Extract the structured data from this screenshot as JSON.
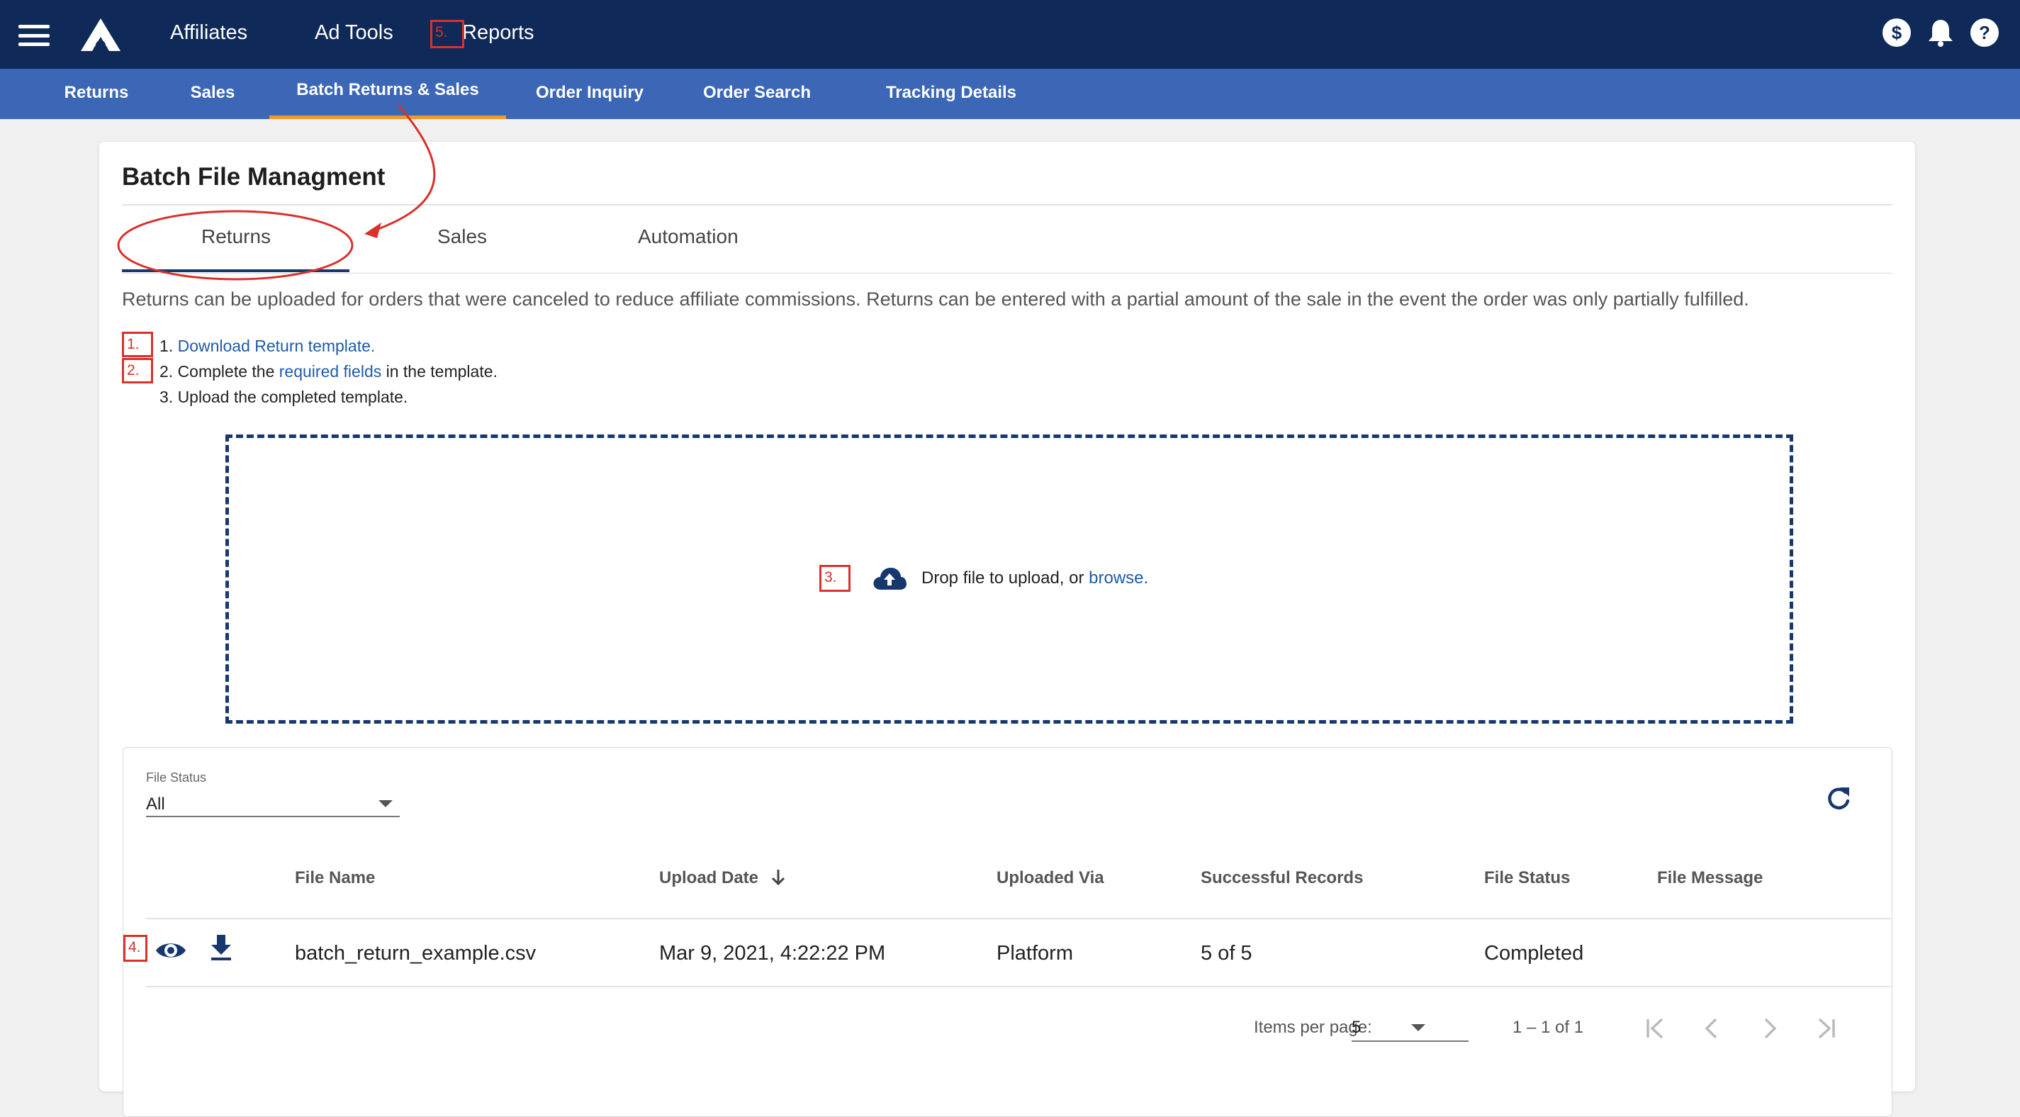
{
  "header": {
    "nav": [
      {
        "label": "Affiliates"
      },
      {
        "label": "Ad Tools"
      },
      {
        "label": "Reports"
      }
    ],
    "icons": [
      "menu-icon",
      "logo",
      "dollar-icon",
      "bell-icon",
      "help-icon"
    ]
  },
  "subnav": {
    "items": [
      {
        "label": "Returns"
      },
      {
        "label": "Sales"
      },
      {
        "label": "Batch Returns & Sales"
      },
      {
        "label": "Order Inquiry"
      },
      {
        "label": "Order Search"
      },
      {
        "label": "Tracking Details"
      }
    ],
    "active_index": 2,
    "accent_color": "#f3962b"
  },
  "page": {
    "title": "Batch File Managment",
    "tabs": [
      {
        "label": "Returns"
      },
      {
        "label": "Sales"
      },
      {
        "label": "Automation"
      }
    ],
    "active_tab": "Returns",
    "intro": "Returns can be uploaded for orders that were canceled to reduce affiliate commissions. Returns can be entered with a partial amount of the sale in the event the order was only partially fulfilled.",
    "steps": {
      "s1_prefix": "1. ",
      "s1_link": "Download Return template.",
      "s2_prefix": "2. Complete the ",
      "s2_link": "required fields",
      "s2_suffix": " in the template.",
      "s3": "3. Upload the completed template."
    },
    "dropzone": {
      "text": "Drop file to upload, or ",
      "link": "browse."
    }
  },
  "table": {
    "filter_label": "File Status",
    "filter_value": "All",
    "columns": [
      "File Name",
      "Upload Date",
      "Uploaded Via",
      "Successful Records",
      "File Status",
      "File Message"
    ],
    "sort_column": "Upload Date",
    "sort_direction": "descending",
    "rows": [
      {
        "file_name": "batch_return_example.csv",
        "upload_date": "Mar 9, 2021, 4:22:22 PM",
        "uploaded_via": "Platform",
        "successful_records": "5 of 5",
        "file_status": "Completed",
        "file_message": ""
      }
    ],
    "paginator": {
      "items_per_page_label": "Items per page:",
      "items_per_page": "5",
      "range": "1 – 1 of 1"
    }
  },
  "annotations": [
    "1.",
    "2.",
    "3.",
    "4.",
    "5."
  ],
  "colors": {
    "header_bg": "#0f2a58",
    "subnav_bg": "#3b67b6",
    "link": "#1f5ba8",
    "annotation": "#d9312b"
  }
}
